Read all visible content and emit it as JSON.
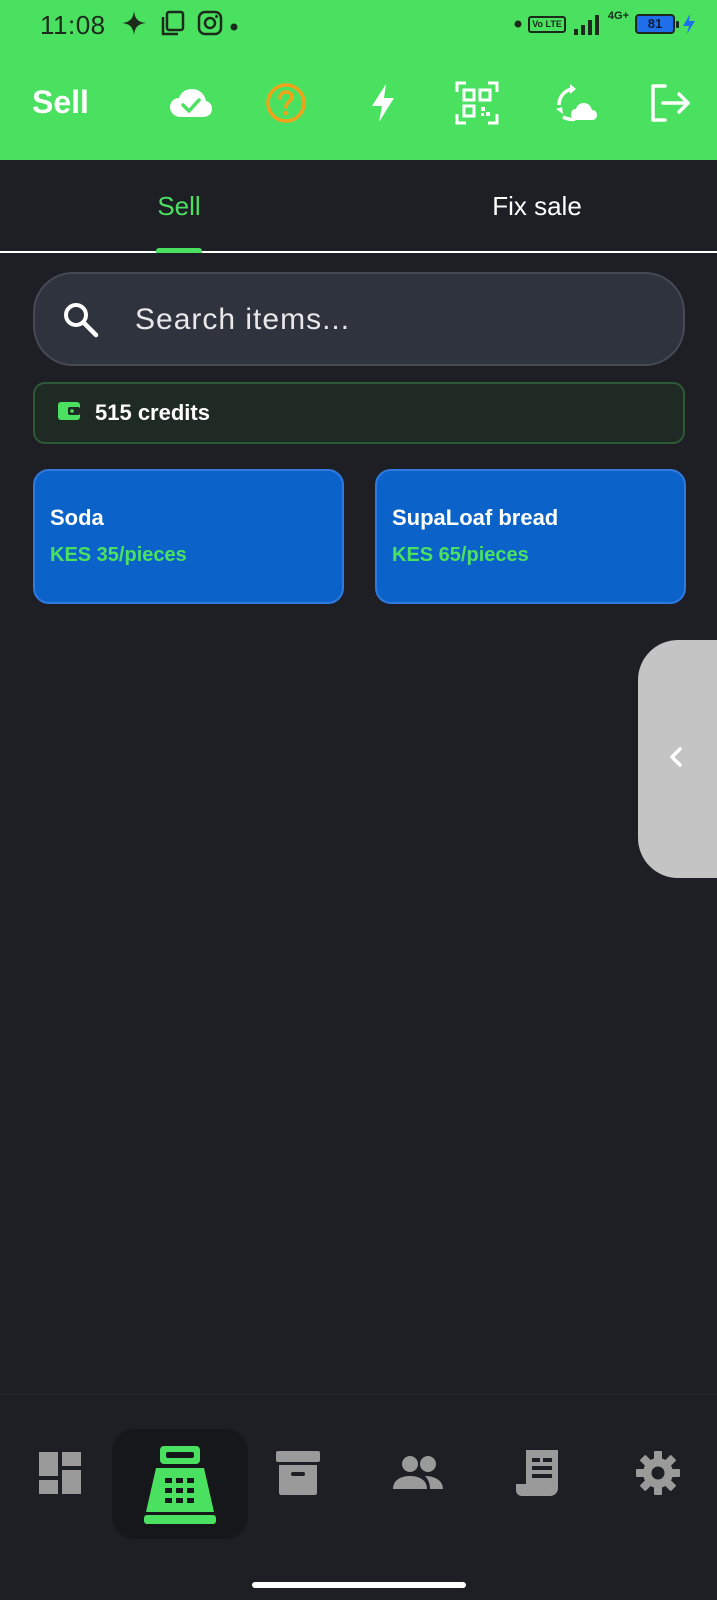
{
  "status_bar": {
    "time": "11:08",
    "volte": "Vo LTE",
    "network": "4G+",
    "battery": "81"
  },
  "app_bar": {
    "title": "Sell",
    "actions": [
      "cloud-done-icon",
      "help-icon",
      "flash-icon",
      "qr-scan-icon",
      "cloud-sync-icon",
      "logout-icon"
    ]
  },
  "tabs": [
    {
      "label": "Sell",
      "active": true
    },
    {
      "label": "Fix sale",
      "active": false
    }
  ],
  "search": {
    "placeholder": "Search items..."
  },
  "credits": {
    "label": "515 credits"
  },
  "items": [
    {
      "name": "Soda",
      "price": "KES 35/pieces"
    },
    {
      "name": "SupaLoaf bread",
      "price": "KES 65/pieces"
    }
  ],
  "bottom_nav": [
    {
      "icon": "dashboard-icon",
      "active": false
    },
    {
      "icon": "cash-register-icon",
      "active": true
    },
    {
      "icon": "archive-icon",
      "active": false
    },
    {
      "icon": "people-icon",
      "active": false
    },
    {
      "icon": "receipt-icon",
      "active": false
    },
    {
      "icon": "settings-icon",
      "active": false
    }
  ],
  "colors": {
    "accent": "#4be160",
    "background": "#1d1f24",
    "item_card": "#0b63c9",
    "help_icon": "#f0a21b"
  }
}
